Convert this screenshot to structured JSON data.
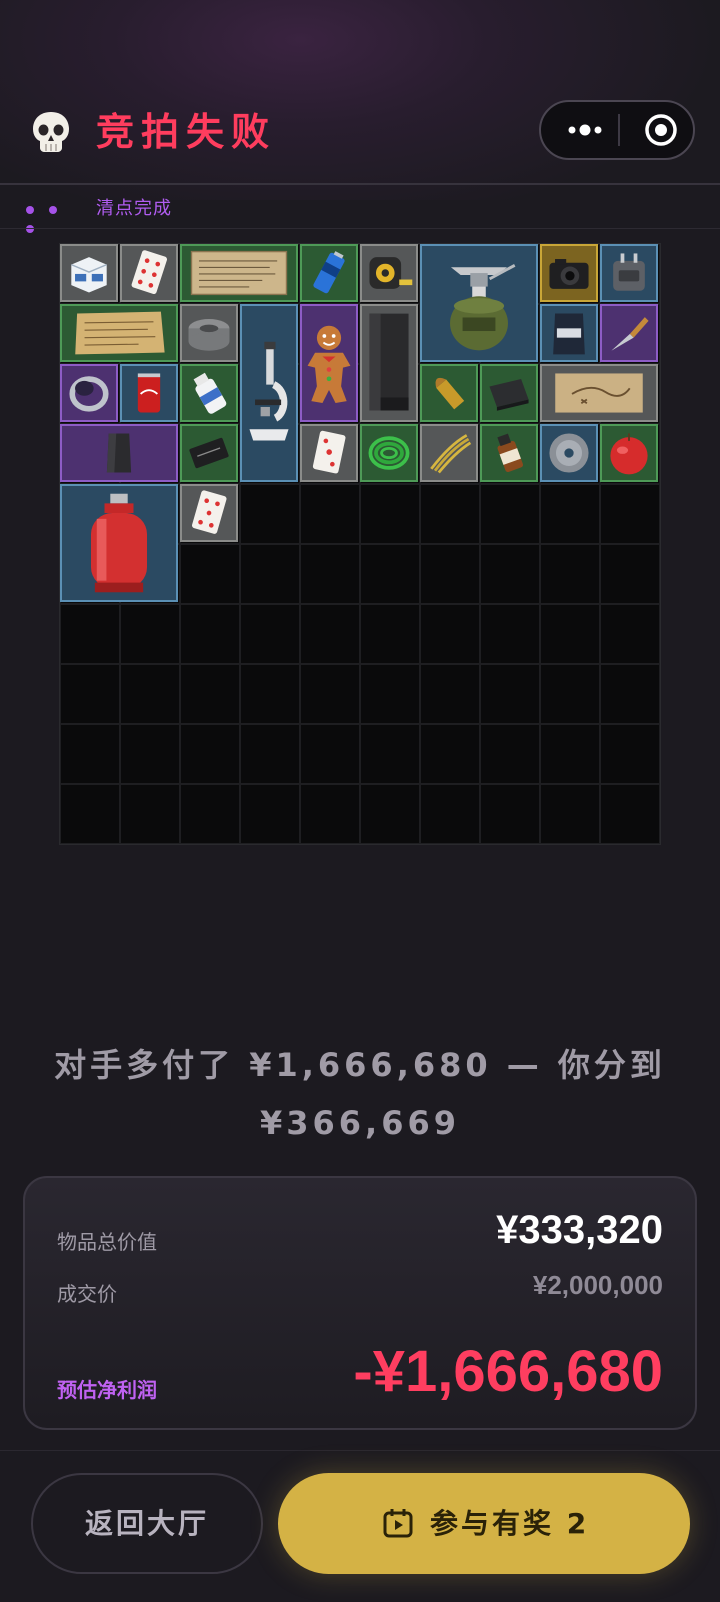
{
  "header": {
    "title": "竞拍失败",
    "status": "清点完成",
    "skull_icon": "skull-icon",
    "more_icon": "more-dots-icon",
    "target_icon": "target-icon",
    "title_color": "#ff3d5e",
    "status_color": "#b05cf0"
  },
  "inventory": {
    "grid": "10x10",
    "items": [
      {
        "name": "sugar-box",
        "rarity": "white"
      },
      {
        "name": "playing-card",
        "rarity": "white"
      },
      {
        "name": "old-document",
        "rarity": "green"
      },
      {
        "name": "blue-battery",
        "rarity": "green"
      },
      {
        "name": "tape-measure",
        "rarity": "white"
      },
      {
        "name": "camping-stove",
        "rarity": "blue"
      },
      {
        "name": "camera",
        "rarity": "gold"
      },
      {
        "name": "travel-adapter",
        "rarity": "blue"
      },
      {
        "name": "parchment",
        "rarity": "green"
      },
      {
        "name": "duct-tape",
        "rarity": "white"
      },
      {
        "name": "microscope",
        "rarity": "blue"
      },
      {
        "name": "gingerbread-man",
        "rarity": "purple"
      },
      {
        "name": "black-panel",
        "rarity": "white"
      },
      {
        "name": "coffee-bag",
        "rarity": "blue"
      },
      {
        "name": "knife",
        "rarity": "purple"
      },
      {
        "name": "ring",
        "rarity": "purple"
      },
      {
        "name": "soda-can",
        "rarity": "blue"
      },
      {
        "name": "glue-bottle",
        "rarity": "green"
      },
      {
        "name": "bullet",
        "rarity": "green"
      },
      {
        "name": "hard-drive",
        "rarity": "green"
      },
      {
        "name": "treasure-map",
        "rarity": "white"
      },
      {
        "name": "armor-plate",
        "rarity": "purple"
      },
      {
        "name": "card-pack",
        "rarity": "green"
      },
      {
        "name": "playing-card",
        "rarity": "white"
      },
      {
        "name": "green-cable",
        "rarity": "green"
      },
      {
        "name": "rope",
        "rarity": "white"
      },
      {
        "name": "medicine-bottle",
        "rarity": "green"
      },
      {
        "name": "cd-disc",
        "rarity": "blue"
      },
      {
        "name": "apple",
        "rarity": "green"
      },
      {
        "name": "gas-cylinder",
        "rarity": "blue"
      },
      {
        "name": "playing-card",
        "rarity": "white"
      }
    ]
  },
  "result": {
    "line1": "对手多付了 ¥1,666,680 — 你分到",
    "line2": "¥366,669"
  },
  "summary": {
    "total_label": "物品总价值",
    "total_value": "¥333,320",
    "deal_label": "成交价",
    "deal_value": "¥2,000,000",
    "profit_label": "预估净利润",
    "profit_value": "-¥1,666,680",
    "profit_color": "#ff3e60"
  },
  "actions": {
    "back_label": "返回大厅",
    "join_label": "参与有奖 2",
    "join_icon": "calendar-play-icon",
    "join_color": "#d4b245"
  }
}
